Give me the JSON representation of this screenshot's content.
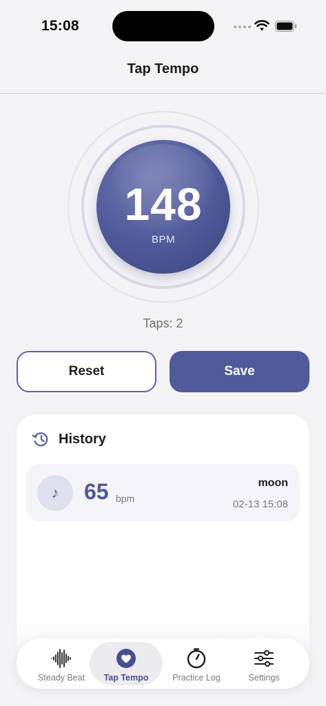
{
  "status_bar": {
    "time": "15:08"
  },
  "nav": {
    "title": "Tap Tempo"
  },
  "tempo": {
    "bpm": "148",
    "unit": "BPM",
    "taps_label": "Taps: 2"
  },
  "actions": {
    "reset_label": "Reset",
    "save_label": "Save"
  },
  "history": {
    "title": "History",
    "entries": [
      {
        "bpm": "65",
        "unit": "bpm",
        "name": "moon",
        "time": "02-13 15:08",
        "icon": "music-note-icon"
      }
    ]
  },
  "tab_bar": {
    "items": [
      {
        "label": "Steady Beat",
        "icon": "waveform-icon",
        "active": false
      },
      {
        "label": "Tap Tempo",
        "icon": "heart-icon",
        "active": true
      },
      {
        "label": "Practice Log",
        "icon": "timer-icon",
        "active": false
      },
      {
        "label": "Settings",
        "icon": "sliders-icon",
        "active": false
      }
    ]
  },
  "colors": {
    "accent": "#515a9a",
    "accent_dark": "#474f8c",
    "background": "#f3f3f6",
    "card": "#ffffff",
    "muted_text": "#7a7a82"
  }
}
